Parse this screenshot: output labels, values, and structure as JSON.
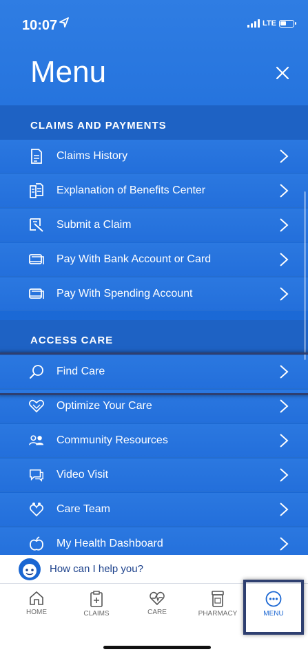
{
  "status_bar": {
    "time": "10:07",
    "network": "LTE"
  },
  "header": {
    "title": "Menu"
  },
  "sections": [
    {
      "title": "CLAIMS AND PAYMENTS",
      "items": [
        {
          "label": "Claims History",
          "icon": "document-icon"
        },
        {
          "label": "Explanation of Benefits Center",
          "icon": "documents-icon"
        },
        {
          "label": "Submit a Claim",
          "icon": "submit-claim-icon"
        },
        {
          "label": "Pay With Bank Account or Card",
          "icon": "card-icon"
        },
        {
          "label": "Pay With Spending Account",
          "icon": "card-icon"
        }
      ]
    },
    {
      "title": "ACCESS CARE",
      "items": [
        {
          "label": "Find Care",
          "icon": "search-icon"
        },
        {
          "label": "Optimize Your Care",
          "icon": "heart-icon"
        },
        {
          "label": "Community Resources",
          "icon": "people-icon"
        },
        {
          "label": "Video Visit",
          "icon": "chat-icon"
        },
        {
          "label": "Care Team",
          "icon": "care-team-icon"
        },
        {
          "label": "My Health Dashboard",
          "icon": "apple-icon"
        }
      ]
    }
  ],
  "chat": {
    "prompt": "How can I help you?"
  },
  "tabs": [
    {
      "label": "HOME",
      "icon": "home-icon"
    },
    {
      "label": "CLAIMS",
      "icon": "clipboard-icon"
    },
    {
      "label": "CARE",
      "icon": "heartbeat-icon"
    },
    {
      "label": "PHARMACY",
      "icon": "pill-bottle-icon"
    },
    {
      "label": "MENU",
      "icon": "more-icon",
      "active": true
    }
  ],
  "colors": {
    "primary": "#1a66d2",
    "header_band": "#1e62c4",
    "highlight_border": "#2e3f70"
  }
}
